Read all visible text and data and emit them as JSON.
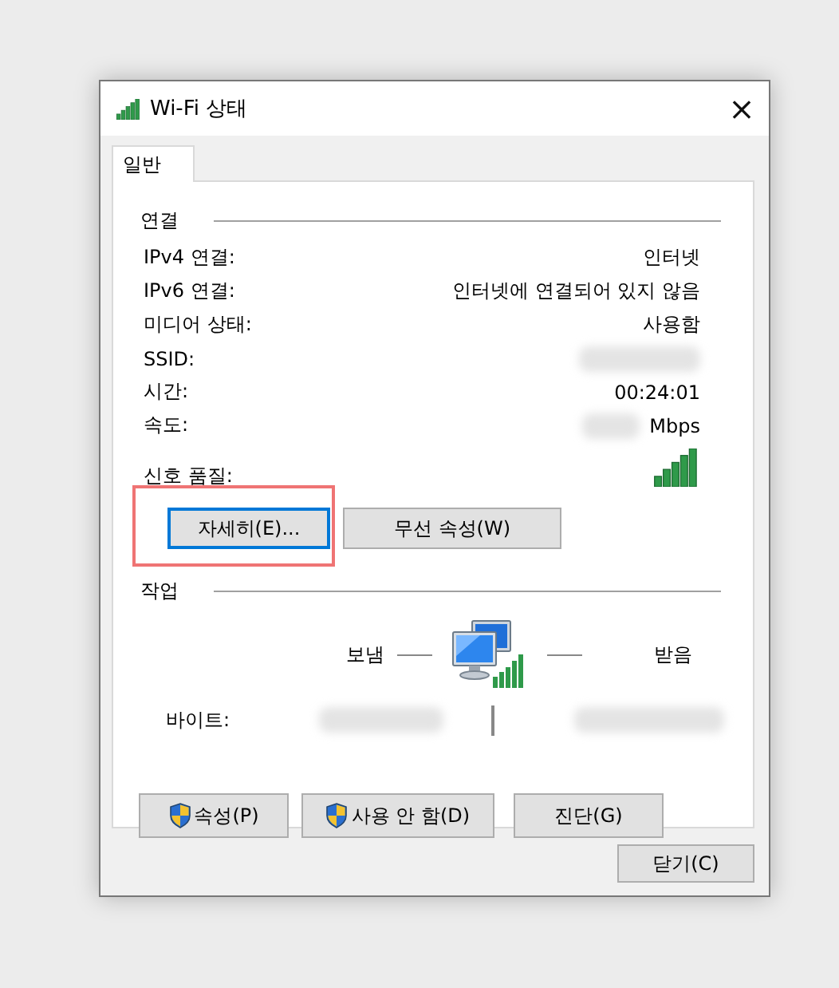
{
  "window": {
    "title": "Wi-Fi 상태",
    "close": "×"
  },
  "tabs": [
    {
      "label": "일반",
      "selected": true
    }
  ],
  "connection": {
    "heading": "연결",
    "rows": [
      {
        "kind": "text",
        "label": "IPv4 연결:",
        "value": "인터넷"
      },
      {
        "kind": "text",
        "label": "IPv6 연결:",
        "value": "인터넷에 연결되어 있지 않음"
      },
      {
        "kind": "text",
        "label": "미디어 상태:",
        "value": "사용함"
      },
      {
        "kind": "redacted",
        "label": "SSID:"
      },
      {
        "kind": "text",
        "label": "시간:",
        "value": "00:24:01"
      },
      {
        "kind": "speed",
        "label": "속도:",
        "value": "Mbps"
      },
      {
        "kind": "signal",
        "label": "신호 품질:"
      }
    ],
    "buttons": [
      {
        "label": "자세히(E)...",
        "focused": true,
        "highlighted": true
      },
      {
        "label": "무선 속성(W)",
        "focused": false,
        "highlighted": false
      }
    ]
  },
  "activity": {
    "heading": "작업",
    "sent": "보냄",
    "received": "받음",
    "bytes_label": "바이트:",
    "buttons": [
      {
        "kind": "shield",
        "label": "속성(P)"
      },
      {
        "kind": "shield",
        "label": "사용 안 함(D)"
      },
      {
        "kind": "plain",
        "label": "진단(G)"
      }
    ]
  },
  "footer": {
    "close_button": "닫기(C)"
  }
}
